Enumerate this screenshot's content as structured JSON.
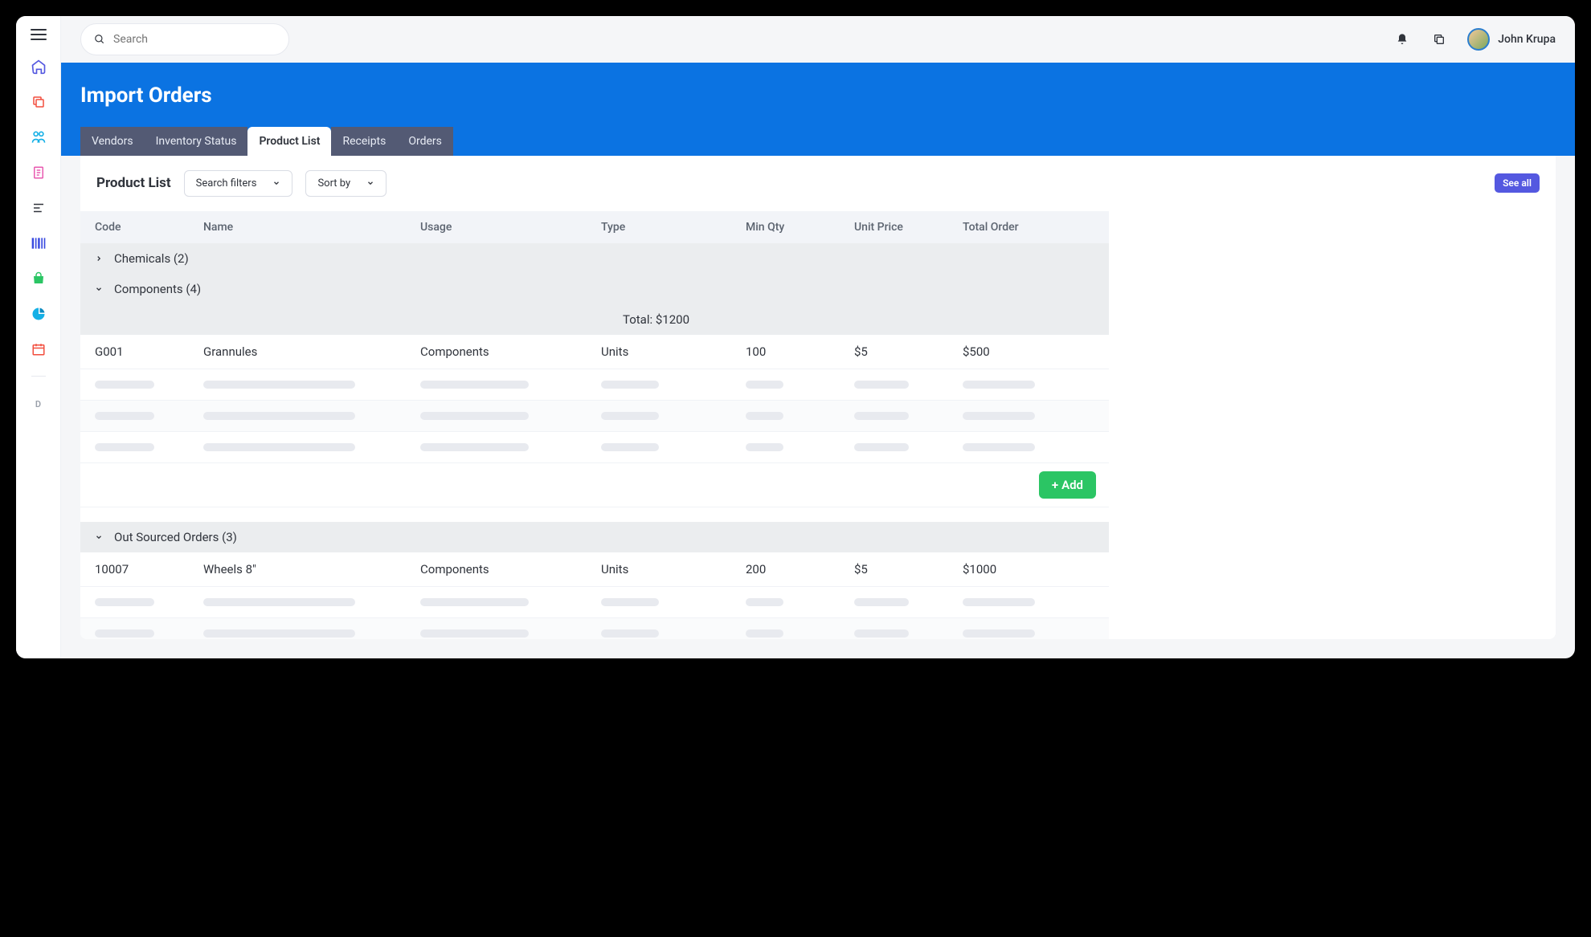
{
  "search": {
    "placeholder": "Search"
  },
  "user": {
    "name": "John Krupa"
  },
  "hero": {
    "title": "Import Orders"
  },
  "tabs": [
    {
      "label": "Vendors",
      "active": false
    },
    {
      "label": "Inventory Status",
      "active": false
    },
    {
      "label": "Product List",
      "active": true
    },
    {
      "label": "Receipts",
      "active": false
    },
    {
      "label": "Orders",
      "active": false
    }
  ],
  "panel": {
    "title": "Product List",
    "filter_label": "Search filters",
    "sort_label": "Sort by",
    "see_all": "See all"
  },
  "columns": [
    "Code",
    "Name",
    "Usage",
    "Type",
    "Min Qty",
    "Unit Price",
    "Total Order"
  ],
  "groups": {
    "chemicals": {
      "label": "Chemicals (2)",
      "expanded": false
    },
    "components": {
      "label": "Components (4)",
      "expanded": true,
      "total_label": "Total: $1200",
      "rows": [
        {
          "code": "G001",
          "name": "Grannules",
          "usage": "Components",
          "type": "Units",
          "min_qty": "100",
          "unit_price": "$5",
          "total": "$500"
        }
      ]
    },
    "outsourced": {
      "label": "Out Sourced Orders (3)",
      "expanded": true,
      "rows": [
        {
          "code": "10007",
          "name": "Wheels 8\"",
          "usage": "Components",
          "type": "Units",
          "min_qty": "200",
          "unit_price": "$5",
          "total": "$1000"
        }
      ]
    }
  },
  "buttons": {
    "add": "Add"
  },
  "sidebar": {
    "d": "D"
  }
}
